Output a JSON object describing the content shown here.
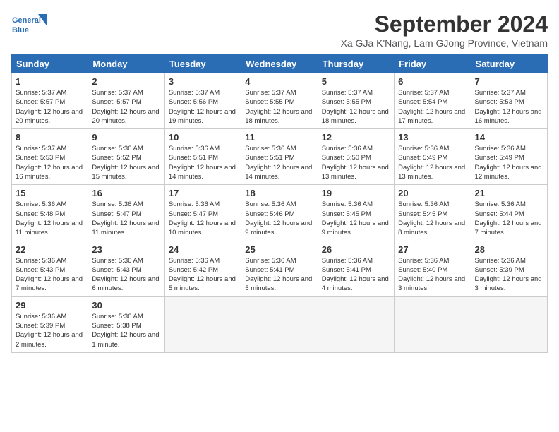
{
  "logo": {
    "line1": "General",
    "line2": "Blue"
  },
  "title": "September 2024",
  "subtitle": "Xa GJa K'Nang, Lam GJong Province, Vietnam",
  "headers": [
    "Sunday",
    "Monday",
    "Tuesday",
    "Wednesday",
    "Thursday",
    "Friday",
    "Saturday"
  ],
  "weeks": [
    [
      {
        "day": "1",
        "sunrise": "5:37 AM",
        "sunset": "5:57 PM",
        "daylight": "12 hours and 20 minutes."
      },
      {
        "day": "2",
        "sunrise": "5:37 AM",
        "sunset": "5:57 PM",
        "daylight": "12 hours and 20 minutes."
      },
      {
        "day": "3",
        "sunrise": "5:37 AM",
        "sunset": "5:56 PM",
        "daylight": "12 hours and 19 minutes."
      },
      {
        "day": "4",
        "sunrise": "5:37 AM",
        "sunset": "5:55 PM",
        "daylight": "12 hours and 18 minutes."
      },
      {
        "day": "5",
        "sunrise": "5:37 AM",
        "sunset": "5:55 PM",
        "daylight": "12 hours and 18 minutes."
      },
      {
        "day": "6",
        "sunrise": "5:37 AM",
        "sunset": "5:54 PM",
        "daylight": "12 hours and 17 minutes."
      },
      {
        "day": "7",
        "sunrise": "5:37 AM",
        "sunset": "5:53 PM",
        "daylight": "12 hours and 16 minutes."
      }
    ],
    [
      {
        "day": "8",
        "sunrise": "5:37 AM",
        "sunset": "5:53 PM",
        "daylight": "12 hours and 16 minutes."
      },
      {
        "day": "9",
        "sunrise": "5:36 AM",
        "sunset": "5:52 PM",
        "daylight": "12 hours and 15 minutes."
      },
      {
        "day": "10",
        "sunrise": "5:36 AM",
        "sunset": "5:51 PM",
        "daylight": "12 hours and 14 minutes."
      },
      {
        "day": "11",
        "sunrise": "5:36 AM",
        "sunset": "5:51 PM",
        "daylight": "12 hours and 14 minutes."
      },
      {
        "day": "12",
        "sunrise": "5:36 AM",
        "sunset": "5:50 PM",
        "daylight": "12 hours and 13 minutes."
      },
      {
        "day": "13",
        "sunrise": "5:36 AM",
        "sunset": "5:49 PM",
        "daylight": "12 hours and 13 minutes."
      },
      {
        "day": "14",
        "sunrise": "5:36 AM",
        "sunset": "5:49 PM",
        "daylight": "12 hours and 12 minutes."
      }
    ],
    [
      {
        "day": "15",
        "sunrise": "5:36 AM",
        "sunset": "5:48 PM",
        "daylight": "12 hours and 11 minutes."
      },
      {
        "day": "16",
        "sunrise": "5:36 AM",
        "sunset": "5:47 PM",
        "daylight": "12 hours and 11 minutes."
      },
      {
        "day": "17",
        "sunrise": "5:36 AM",
        "sunset": "5:47 PM",
        "daylight": "12 hours and 10 minutes."
      },
      {
        "day": "18",
        "sunrise": "5:36 AM",
        "sunset": "5:46 PM",
        "daylight": "12 hours and 9 minutes."
      },
      {
        "day": "19",
        "sunrise": "5:36 AM",
        "sunset": "5:45 PM",
        "daylight": "12 hours and 9 minutes."
      },
      {
        "day": "20",
        "sunrise": "5:36 AM",
        "sunset": "5:45 PM",
        "daylight": "12 hours and 8 minutes."
      },
      {
        "day": "21",
        "sunrise": "5:36 AM",
        "sunset": "5:44 PM",
        "daylight": "12 hours and 7 minutes."
      }
    ],
    [
      {
        "day": "22",
        "sunrise": "5:36 AM",
        "sunset": "5:43 PM",
        "daylight": "12 hours and 7 minutes."
      },
      {
        "day": "23",
        "sunrise": "5:36 AM",
        "sunset": "5:43 PM",
        "daylight": "12 hours and 6 minutes."
      },
      {
        "day": "24",
        "sunrise": "5:36 AM",
        "sunset": "5:42 PM",
        "daylight": "12 hours and 5 minutes."
      },
      {
        "day": "25",
        "sunrise": "5:36 AM",
        "sunset": "5:41 PM",
        "daylight": "12 hours and 5 minutes."
      },
      {
        "day": "26",
        "sunrise": "5:36 AM",
        "sunset": "5:41 PM",
        "daylight": "12 hours and 4 minutes."
      },
      {
        "day": "27",
        "sunrise": "5:36 AM",
        "sunset": "5:40 PM",
        "daylight": "12 hours and 3 minutes."
      },
      {
        "day": "28",
        "sunrise": "5:36 AM",
        "sunset": "5:39 PM",
        "daylight": "12 hours and 3 minutes."
      }
    ],
    [
      {
        "day": "29",
        "sunrise": "5:36 AM",
        "sunset": "5:39 PM",
        "daylight": "12 hours and 2 minutes."
      },
      {
        "day": "30",
        "sunrise": "5:36 AM",
        "sunset": "5:38 PM",
        "daylight": "12 hours and 1 minute."
      },
      null,
      null,
      null,
      null,
      null
    ]
  ]
}
